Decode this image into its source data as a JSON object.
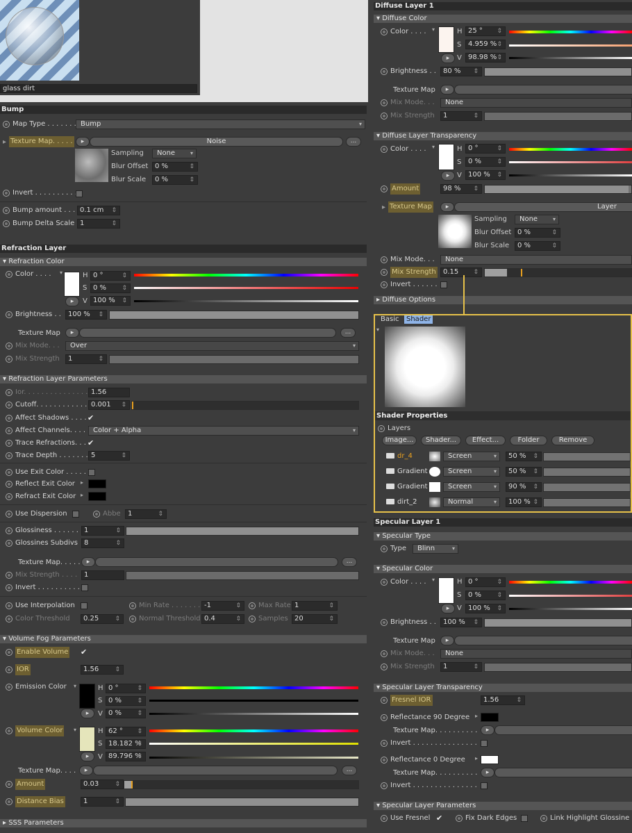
{
  "material_preview": {
    "name": "glass dirt"
  },
  "bump": {
    "title": "Bump",
    "map_type_label": "Map Type . . . . . . .",
    "map_type_value": "Bump",
    "texture_map_label": "Texture Map. . . . .",
    "texture_value": "Noise",
    "sampling_label": "Sampling",
    "sampling_value": "None",
    "blur_offset_label": "Blur Offset",
    "blur_offset_value": "0 %",
    "blur_scale_label": "Blur Scale",
    "blur_scale_value": "0 %",
    "invert_label": "Invert . . . . . . . . . .",
    "bump_amount_label": "Bump amount . . .",
    "bump_amount_value": "0.1 cm",
    "bump_delta_label": "Bump Delta Scale",
    "bump_delta_value": "1"
  },
  "refraction": {
    "title": "Refraction Layer",
    "color_section": "▾ Refraction Color",
    "color_label": "Color . . . .",
    "h_label": "H",
    "h_value": "0 °",
    "s_label": "S",
    "s_value": "0 %",
    "v_label": "V",
    "v_value": "100 %",
    "brightness_label": "Brightness . .",
    "brightness_value": "100 %",
    "texture_map_label": "Texture Map",
    "mix_mode_label": "Mix Mode. . .",
    "mix_mode_value": "Over",
    "mix_strength_label": "Mix Strength",
    "mix_strength_value": "1",
    "params_section": "▾ Refraction Layer Parameters",
    "ior_label": "Ior. . . . . . . . . . . . . . .",
    "ior_value": "1.56",
    "cutoff_label": "Cutoff. . . . . . . . . . . .",
    "cutoff_value": "0.001",
    "affect_shadows_label": "Affect Shadows . . . .",
    "affect_channels_label": "Affect Channels. . . .",
    "affect_channels_value": "Color + Alpha",
    "trace_refractions_label": "Trace Refractions. . .",
    "trace_depth_label": "Trace Depth . . . . . . .",
    "trace_depth_value": "5",
    "use_exit_color_label": "Use Exit Color . . . . .",
    "reflect_exit_label": "Reflect Exit Color",
    "refract_exit_label": "Refract Exit Color",
    "use_dispersion_label": "Use Dispersion",
    "abbe_label": "Abbe",
    "abbe_value": "1",
    "glossiness_label": "Glossiness . . . . . .",
    "glossiness_value": "1",
    "gloss_subdivs_label": "Glossines Subdivs",
    "gloss_subdivs_value": "8",
    "texture_map2_label": "Texture Map. . . . .",
    "mix_strength2_label": "Mix Strength . . . .",
    "mix_strength2_value": "1",
    "invert_label": "Invert . . . . . . . . . .",
    "use_interp_label": "Use Interpolation",
    "min_rate_label": "Min Rate . . . . . . .",
    "min_rate_value": "-1",
    "max_rate_label": "Max Rate",
    "max_rate_value": "1",
    "color_threshold_label": "Color Threshold",
    "color_threshold_value": "0.25",
    "normal_threshold_label": "Normal Threshold",
    "normal_threshold_value": "0.4",
    "samples_label": "Samples",
    "samples_value": "20",
    "volume_section": "▾ Volume Fog Parameters",
    "enable_volume_label": "Enable Volume",
    "ior2_label": "IOR",
    "ior2_value": "1.56",
    "emission_label": "Emission Color",
    "em_h_value": "0 °",
    "em_s_value": "0 %",
    "em_v_value": "0 %",
    "volume_color_label": "Volume Color",
    "vc_h_value": "62 °",
    "vc_s_value": "18.182 %",
    "vc_v_value": "89.796 %",
    "texture_map3_label": "Texture Map. . . .",
    "amount_label": "Amount",
    "amount_value": "0.03",
    "distance_bias_label": "Distance Bias",
    "distance_bias_value": "1",
    "sss_section": "▸ SSS Parameters"
  },
  "diffuse": {
    "title": "Diffuse Layer 1",
    "color_section": "▾ Diffuse Color",
    "color_label": "Color . . . .",
    "h_value": "25 °",
    "s_value": "4.959 %",
    "v_value": "98.98 %",
    "brightness_label": "Brightness . .",
    "brightness_value": "80 %",
    "texture_map_label": "Texture Map",
    "mix_mode_label": "Mix Mode. . .",
    "mix_mode_value": "None",
    "mix_strength_label": "Mix Strength",
    "mix_strength_value": "1",
    "transp_section": "▾ Diffuse Layer Transparency",
    "t_color_label": "Color . . . .",
    "t_h_value": "0 °",
    "t_s_value": "0 %",
    "t_v_value": "100 %",
    "amount_label": "Amount",
    "amount_value": "98 %",
    "t_texture_label": "Texture Map",
    "t_texture_value": "Layer",
    "sampling_label": "Sampling",
    "sampling_value": "None",
    "blur_offset_label": "Blur Offset",
    "blur_offset_value": "0 %",
    "blur_scale_label": "Blur Scale",
    "blur_scale_value": "0 %",
    "t_mix_mode_label": "Mix Mode. . .",
    "t_mix_mode_value": "None",
    "t_mix_strength_label": "Mix Strength",
    "t_mix_strength_value": "0.15",
    "t_invert_label": "Invert . . . . . .",
    "options_section": "▸ Diffuse Options"
  },
  "shader_popup": {
    "tab_basic": "Basic",
    "tab_shader": "Shader",
    "props_title": "Shader Properties",
    "layers_label": "Layers",
    "buttons": [
      "Image...",
      "Shader...",
      "Effect...",
      "Folder",
      "Remove"
    ],
    "layers": [
      {
        "name": "dr_4",
        "mode": "Screen",
        "opacity": "50 %"
      },
      {
        "name": "Gradient",
        "mode": "Screen",
        "opacity": "50 %"
      },
      {
        "name": "Gradient",
        "mode": "Screen",
        "opacity": "90 %"
      },
      {
        "name": "dirt_2",
        "mode": "Normal",
        "opacity": "100 %"
      }
    ]
  },
  "specular": {
    "title": "Specular Layer 1",
    "type_section": "▾ Specular Type",
    "type_label": "Type",
    "type_value": "Blinn",
    "color_section": "▾ Specular Color",
    "color_label": "Color . . . .",
    "h_value": "0 °",
    "s_value": "0 %",
    "v_value": "100 %",
    "brightness_label": "Brightness . .",
    "brightness_value": "100 %",
    "texture_map_label": "Texture Map",
    "mix_mode_label": "Mix Mode. . .",
    "mix_mode_value": "None",
    "mix_strength_label": "Mix Strength",
    "mix_strength_value": "1",
    "transp_section": "▾ Specular Layer Transparency",
    "fresnel_ior_label": "Fresnel IOR",
    "fresnel_ior_value": "1.56",
    "refl90_label": "Reflectance 90 Degree",
    "tex1_label": "Texture Map. . . . . . . . . .",
    "invert1_label": "Invert . . . . . . . . . . . . . . .",
    "refl0_label": "Reflectance  0 Degree",
    "tex2_label": "Texture Map. . . . . . . . . .",
    "invert2_label": "Invert . . . . . . . . . . . . . . .",
    "params_section": "▾ Specular Layer Parameters",
    "use_fresnel_label": "Use Fresnel",
    "fix_dark_label": "Fix Dark Edges",
    "link_highlight_label": "Link Highlight Glossine"
  },
  "colors": {
    "accent": "#e8c24a",
    "highlight": "#6d5f31",
    "panel": "#3c3c3c"
  }
}
